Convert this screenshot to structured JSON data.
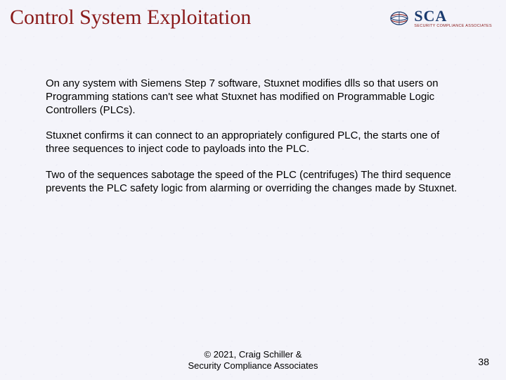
{
  "title": "Control System Exploitation",
  "logo": {
    "main": "SCA",
    "sub": "SECURITY COMPLIANCE ASSOCIATES"
  },
  "paragraphs": [
    "On any system with Siemens Step 7 software, Stuxnet modifies dlls so that users on Programming stations can't see what Stuxnet has modified on Programmable Logic Controllers (PLCs).",
    "Stuxnet confirms it can connect to an appropriately configured PLC, the starts one of three sequences to inject code to payloads into the PLC.",
    "Two of the sequences sabotage the speed of the PLC (centrifuges) The third sequence prevents the PLC safety logic from alarming or overriding the changes made by Stuxnet."
  ],
  "footer": {
    "line1": "© 2021, Craig Schiller &",
    "line2": "Security Compliance Associates"
  },
  "page_number": "38"
}
